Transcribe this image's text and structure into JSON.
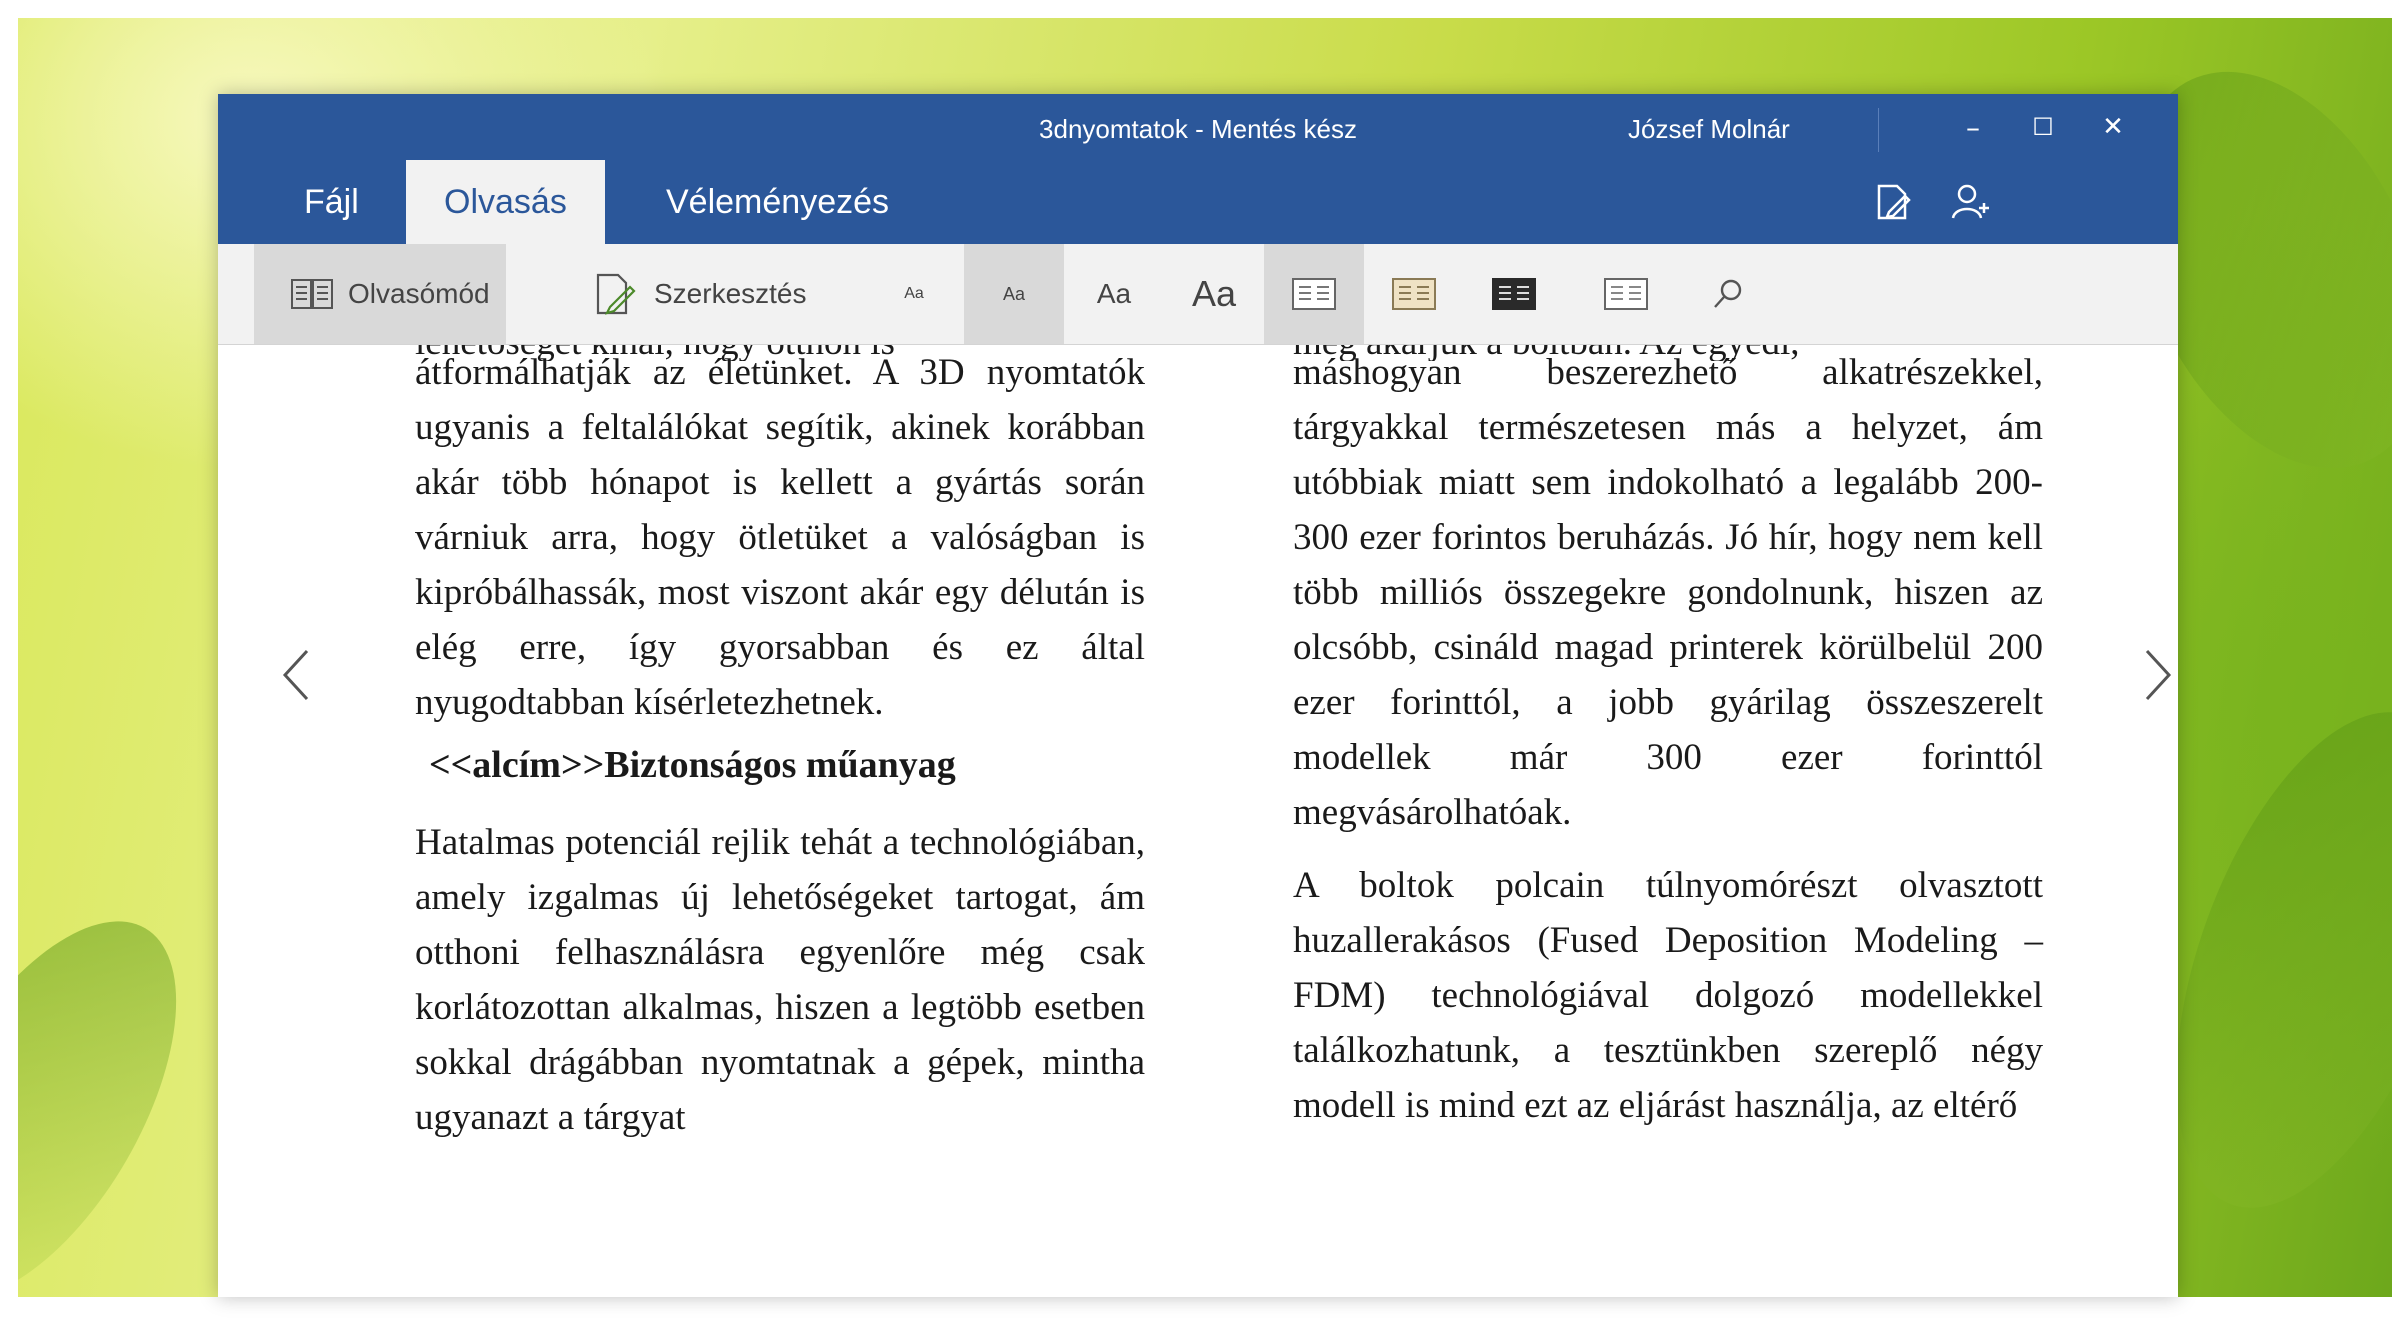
{
  "window": {
    "doc_title": "3dnyomtatok - Mentés kész",
    "user_name": "József Molnár",
    "minimize": "–",
    "maximize": "☐",
    "close": "✕"
  },
  "tabs": [
    {
      "label": "Fájl",
      "active": false
    },
    {
      "label": "Olvasás",
      "active": true
    },
    {
      "label": "Véleményezés",
      "active": false
    }
  ],
  "ribbon": {
    "reading_mode": "Olvasómód",
    "edit": "Szerkesztés",
    "font_sizes": [
      "Aa",
      "Aa",
      "Aa",
      "Aa"
    ],
    "selected_font_size_index": 1
  },
  "document": {
    "left_cut": "lehetőséget kínál, hogy otthon is",
    "left_p1": "átformálhatják az életünket. A 3D nyomtatók ugyanis a feltalálókat segítik, akinek korábban akár több hónapot is kellett a gyártás során várniuk arra, hogy ötletüket a valóságban is kipróbálhassák, most viszont akár egy délután is elég erre, így gyorsabban és ez által nyugodtabban kísérletezhetnek.",
    "left_heading": "<<alcím>>Biztonságos műanyag",
    "left_p2": "Hatalmas potenciál rejlik tehát a technológiában, amely izgalmas új lehetőségeket tartogat, ám otthoni felhasználásra egyenlőre még csak korlátozottan alkalmas, hiszen a legtöbb esetben sokkal drágábban nyomtatnak a gépek, mintha ugyanazt a tárgyat",
    "right_cut": "meg akarjuk a boltban. Az egyedi,",
    "right_p1": "máshogyan beszerezhető alkatrészekkel, tárgyakkal természetesen más a helyzet, ám utóbbiak miatt sem indokolható a legalább 200-300 ezer forintos beruházás. Jó hír, hogy nem kell több milliós összegekre gondolnunk, hiszen az olcsóbb, csináld magad printerek körülbelül 200 ezer forinttól, a jobb gyárilag összeszerelt modellek már 300 ezer forinttól megvásárolhatóak.",
    "right_p2": "A boltok polcain túlnyomórészt olvasztott huzallerakásos (Fused Deposition Modeling – FDM) technológiával dolgozó modellekkel találkozhatunk, a tesztünkben szereplő négy modell is mind ezt az eljárást használja, az eltérő"
  },
  "colors": {
    "title_bar": "#2b579a",
    "ribbon_bg": "#f2f2f2",
    "pressed_bg": "#d9d9d9"
  }
}
